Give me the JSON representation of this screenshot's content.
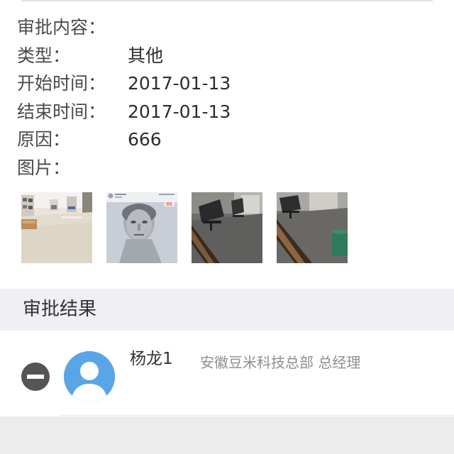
{
  "details": {
    "approval_content_label": "审批内容：",
    "type_label": "类型：",
    "type_value": "其他",
    "start_label": "开始时间：",
    "start_value": "2017-01-13",
    "end_label": "结束时间：",
    "end_value": "2017-01-13",
    "reason_label": "原因：",
    "reason_value": "666",
    "images_label": "图片："
  },
  "images": [
    {
      "icon": "office-room-photo"
    },
    {
      "icon": "portrait-sketch-photo"
    },
    {
      "icon": "office-chairs-photo"
    },
    {
      "icon": "office-floor-photo"
    }
  ],
  "approval_result": {
    "section_title": "审批结果",
    "approver": {
      "name": "杨龙1",
      "org_title": "安徽豆米科技总部 总经理",
      "status_icon": "remove-circle-icon",
      "avatar_icon": "default-avatar-icon"
    }
  },
  "colors": {
    "background": "#ffffff",
    "section_band": "#efeff4",
    "avatar_blue": "#5aa5e6",
    "secondary_text": "#8e8e8e",
    "remove_icon": "#555555"
  }
}
